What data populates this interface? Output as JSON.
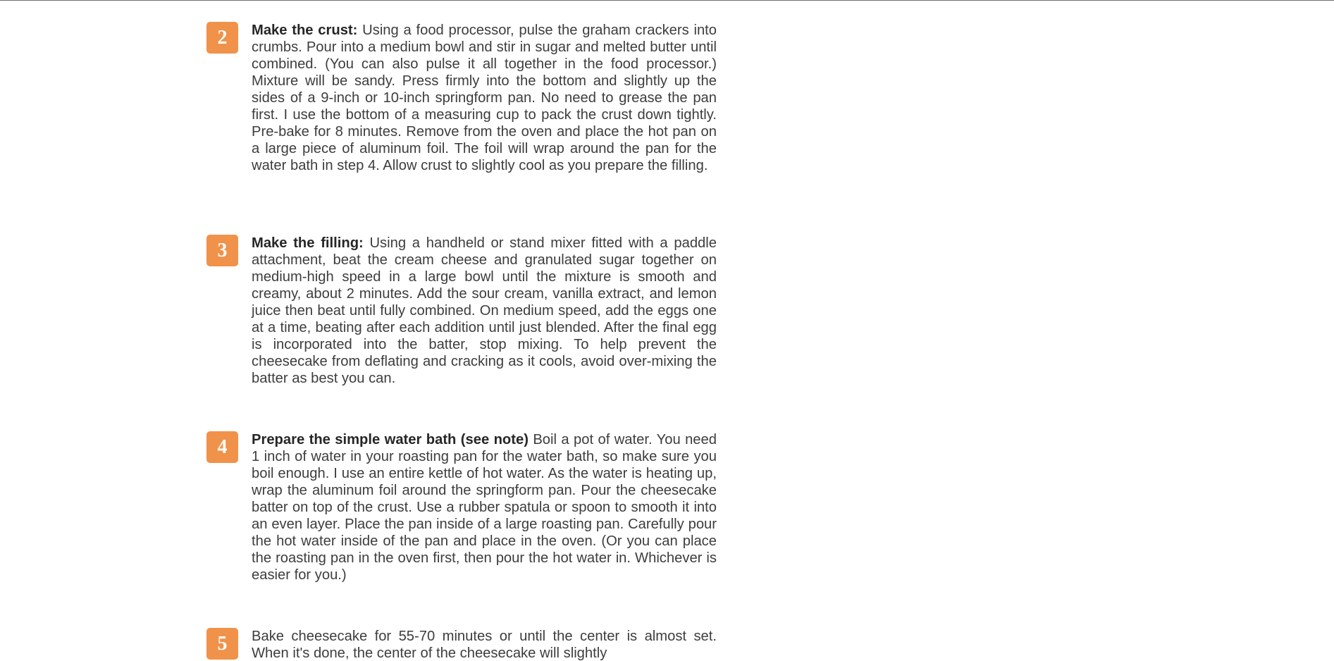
{
  "instructions": {
    "steps": [
      {
        "number": "2",
        "title": "Make the crust:",
        "text": "Using a food processor, pulse the graham crackers into crumbs. Pour into a medium bowl and stir in sugar and melted butter until combined. (You can also pulse it all together in the food processor.) Mixture will be sandy. Press firmly into the bottom and slightly up the sides of a 9-inch or 10-inch springform pan. No need to grease the pan first. I use the bottom of a measuring cup to pack the crust down tightly. Pre-bake for 8 minutes. Remove from the oven and place the hot pan on a large piece of aluminum foil. The foil will wrap around the pan for the water bath in step 4. Allow crust to slightly cool as you prepare the filling."
      },
      {
        "number": "3",
        "title": "Make the filling:",
        "text": "Using a handheld or stand mixer fitted with a paddle attachment, beat the cream cheese and granulated sugar together on medium-high speed in a large bowl until the mixture is smooth and creamy, about 2 minutes. Add the sour cream, vanilla extract, and lemon juice then beat until fully combined. On medium speed, add the eggs one at a time, beating after each addition until just blended. After the final egg is incorporated into the batter, stop mixing. To help prevent the cheesecake from deflating and cracking as it cools, avoid over-mixing the batter as best you can."
      },
      {
        "number": "4",
        "title": "Prepare the simple water bath (see note)",
        "text": "Boil a pot of water. You need 1 inch of water in your roasting pan for the water bath, so make sure you boil enough. I use an entire kettle of hot water. As the water is heating up, wrap the aluminum foil around the springform pan. Pour the cheesecake batter on top of the crust. Use a rubber spatula or spoon to smooth it into an even layer. Place the pan inside of a large roasting pan. Carefully pour the hot water inside of the pan and place in the oven. (Or you can place the roasting pan in the oven first, then pour the hot water in. Whichever is easier for you.)"
      },
      {
        "number": "5",
        "title": "",
        "text": "Bake cheesecake for 55-70 minutes or until the center is almost set. When it's done, the center of the cheesecake will slightly"
      }
    ]
  },
  "colors": {
    "badge_background": "#f0924a",
    "badge_text": "#ffffff",
    "body_text": "#3d3d3d",
    "title_text": "#262626"
  }
}
